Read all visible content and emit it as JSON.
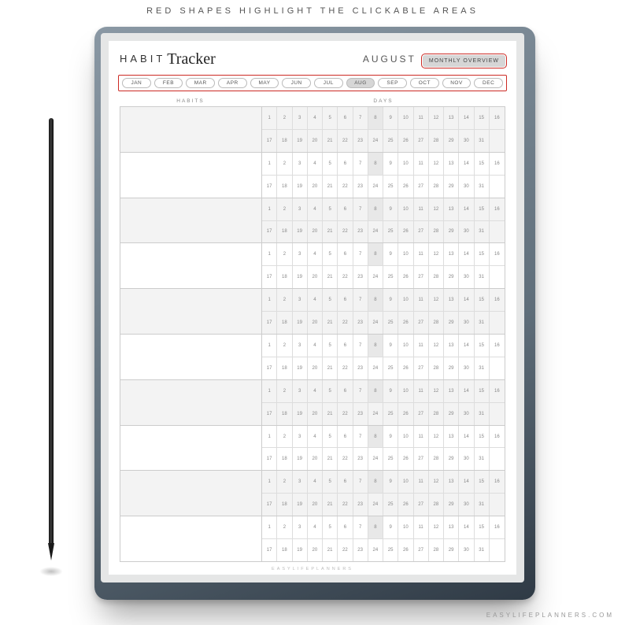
{
  "caption": "RED SHAPES HIGHLIGHT THE CLICKABLE AREAS",
  "header": {
    "title_plain": "HABIT",
    "title_script": "Tracker",
    "current_month": "AUGUST",
    "overview_button": "MONTHLY OVERVIEW"
  },
  "months": [
    "JAN",
    "FEB",
    "MAR",
    "APR",
    "MAY",
    "JUN",
    "JUL",
    "AUG",
    "SEP",
    "OCT",
    "NOV",
    "DEC"
  ],
  "active_month_index": 7,
  "columns": {
    "habits": "HABITS",
    "days": "DAYS"
  },
  "habit_rows": 10,
  "day_rows_per_habit": 2,
  "days_row1": [
    1,
    2,
    3,
    4,
    5,
    6,
    7,
    8,
    9,
    10,
    11,
    12,
    13,
    14,
    15,
    16
  ],
  "days_row2": [
    17,
    18,
    19,
    20,
    21,
    22,
    23,
    24,
    25,
    26,
    27,
    28,
    29,
    30,
    31,
    null
  ],
  "highlight_days": [
    8
  ],
  "footer_brand": "EASYLIFEPLANNERS",
  "corner_brand": "EASYLIFEPLANNERS.COM"
}
